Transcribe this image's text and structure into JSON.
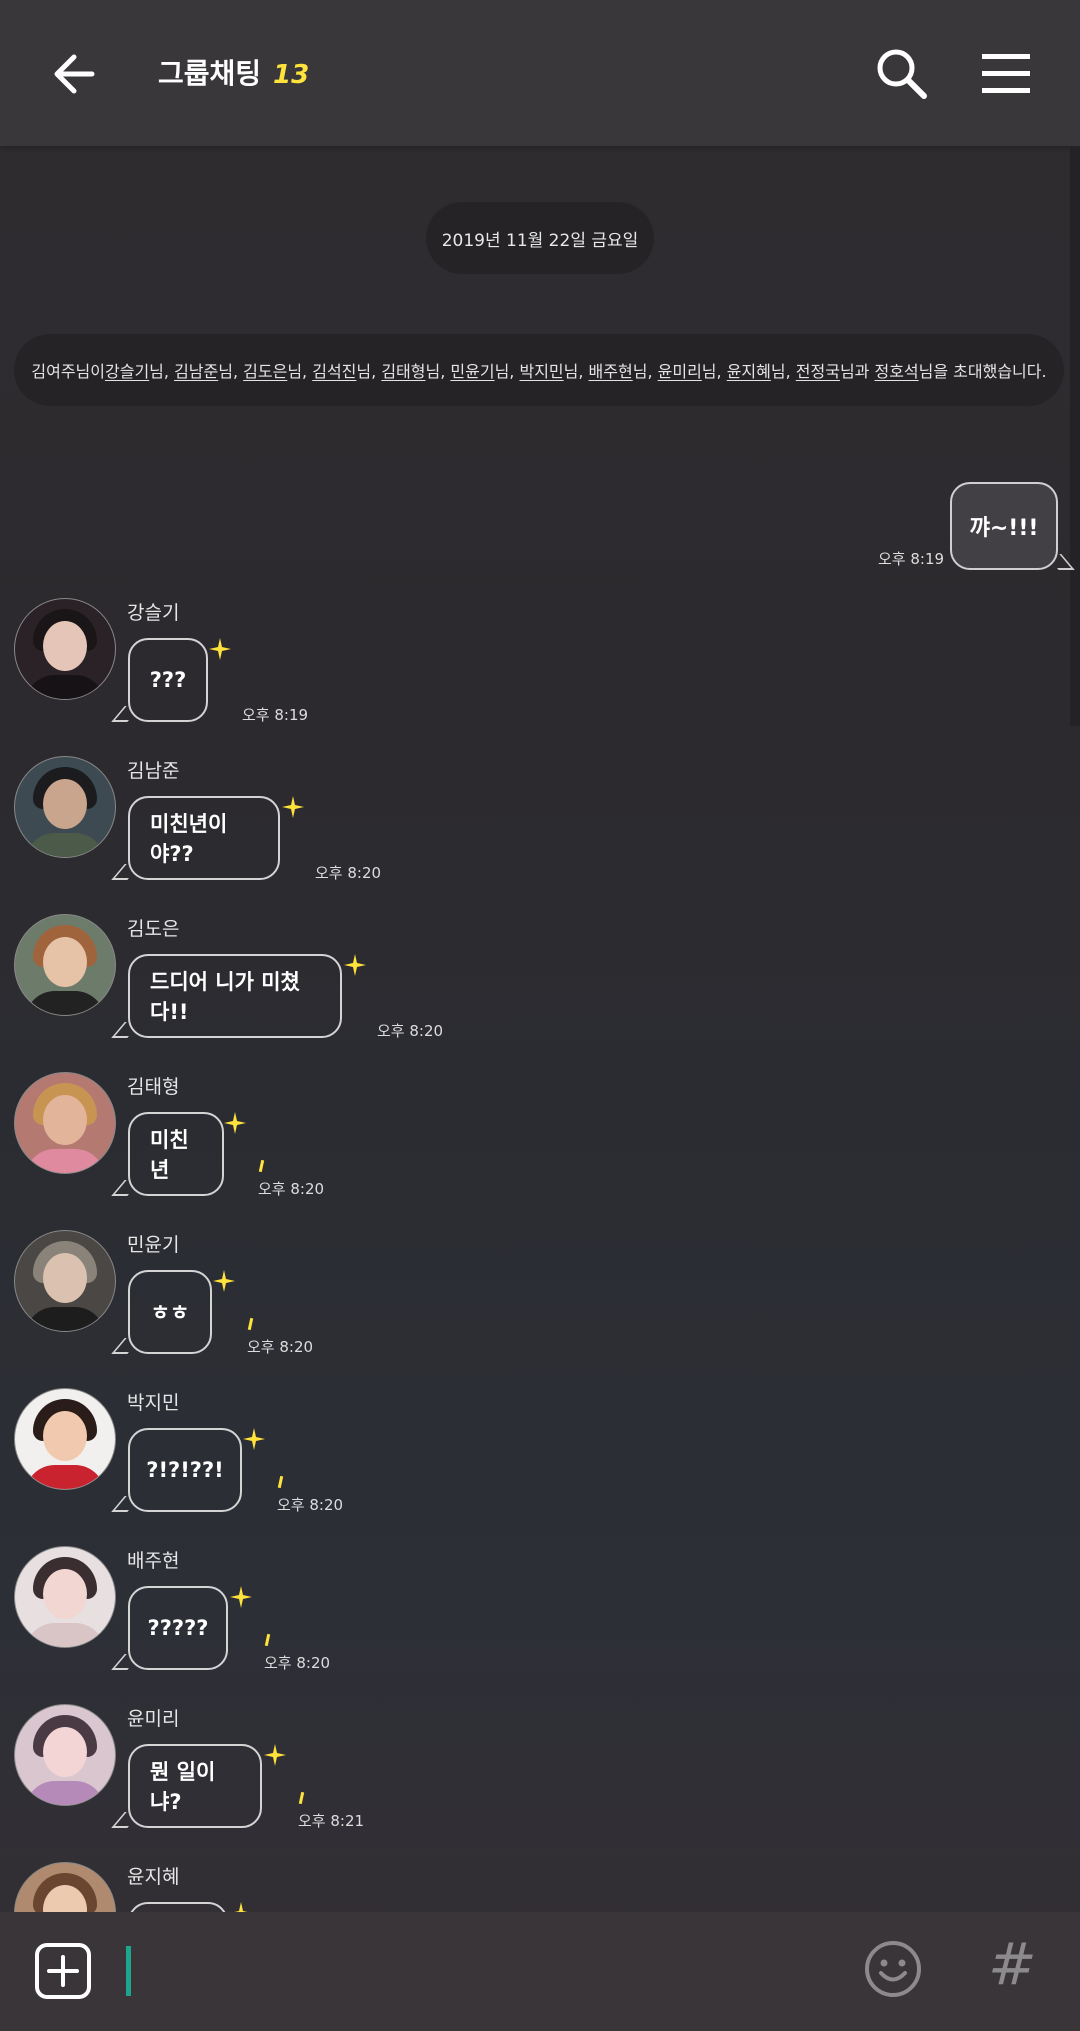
{
  "header": {
    "title": "그룹채팅",
    "member_count": "13"
  },
  "date_divider": "2019년 11월 22일 금요일",
  "system_message": {
    "prefix": "김여주님이 ",
    "members": [
      {
        "name": "강슬기",
        "suffix": "님, "
      },
      {
        "name": "김남준",
        "suffix": "님, "
      },
      {
        "name": "김도은",
        "suffix": "님, "
      },
      {
        "name": "김석진",
        "suffix": "님, "
      },
      {
        "name": "김태형",
        "suffix": "님, "
      },
      {
        "name": "민윤기",
        "suffix": "님, "
      },
      {
        "name": "박지민",
        "suffix": "님, "
      },
      {
        "name": "배주현",
        "suffix": "님, "
      },
      {
        "name": "윤미리",
        "suffix": "님, "
      },
      {
        "name": "윤지혜",
        "suffix": "님, "
      },
      {
        "name": "전정국",
        "suffix": "님과 "
      },
      {
        "name": "정호석",
        "suffix": "님을 초대했습니다."
      }
    ]
  },
  "my_message": {
    "text": "꺄~!!!",
    "time": "오후 8:19"
  },
  "messages": [
    {
      "sender": "강슬기",
      "text": "???",
      "time": "오후 8:19"
    },
    {
      "sender": "김남준",
      "text": "미친년이야??",
      "time": "오후 8:20"
    },
    {
      "sender": "김도은",
      "text": "드디어 니가 미쳤다!!",
      "time": "오후 8:20"
    },
    {
      "sender": "김태형",
      "text": "미친년",
      "time": "오후 8:20"
    },
    {
      "sender": "민윤기",
      "text": "ㅎㅎ",
      "time": "오후 8:20"
    },
    {
      "sender": "박지민",
      "text": "?!?!??!",
      "time": "오후 8:20"
    },
    {
      "sender": "배주현",
      "text": "?????",
      "time": "오후 8:20"
    },
    {
      "sender": "윤미리",
      "text": "뭔 일이냐?",
      "time": "오후 8:21"
    },
    {
      "sender": "윤지혜",
      "text": "",
      "time": ""
    }
  ],
  "colors": {
    "accent_count": "#ffe23b",
    "cursor": "#1ea58d",
    "sparkle": "#ffe23b"
  },
  "icons": {
    "back": "arrow-left-icon",
    "search": "search-icon",
    "menu": "hamburger-menu-icon",
    "attach": "plus-box-icon",
    "emoji": "smiley-icon",
    "hashtag": "hash-icon"
  }
}
